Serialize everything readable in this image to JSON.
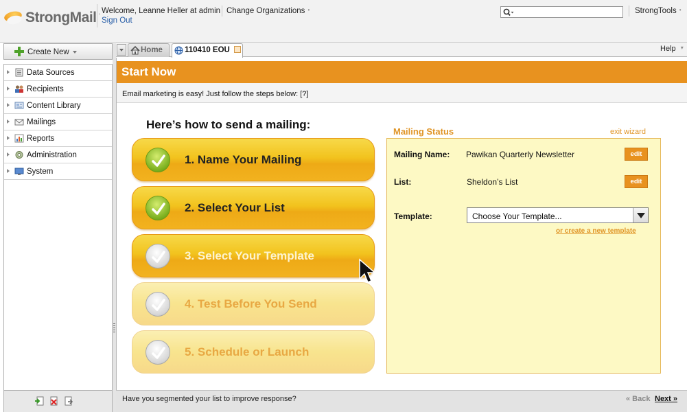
{
  "header": {
    "logo_text": "StrongMail",
    "welcome": "Welcome, Leanne Heller at admin",
    "sign_out": "Sign Out",
    "change_orgs": "Change Organizations",
    "strongtools": "StrongTools",
    "search_placeholder": ""
  },
  "sidebar": {
    "create_new": "Create New",
    "items": [
      {
        "label": "Data Sources",
        "icon": "data-sources-icon"
      },
      {
        "label": "Recipients",
        "icon": "recipients-icon"
      },
      {
        "label": "Content Library",
        "icon": "content-library-icon"
      },
      {
        "label": "Mailings",
        "icon": "mailings-icon"
      },
      {
        "label": "Reports",
        "icon": "reports-icon"
      },
      {
        "label": "Administration",
        "icon": "administration-icon"
      },
      {
        "label": "System",
        "icon": "system-icon"
      }
    ]
  },
  "tabs": {
    "home": "Home",
    "active": "110410 EOU",
    "help": "Help"
  },
  "main": {
    "banner": "Start Now",
    "intro": "Email marketing is easy! Just follow the steps below: [?]",
    "howto": "Here’s how to send a mailing:",
    "steps": [
      {
        "label": "1. Name Your Mailing"
      },
      {
        "label": "2. Select Your List"
      },
      {
        "label": "3. Select Your Template"
      },
      {
        "label": "4. Test Before You Send"
      },
      {
        "label": "5. Schedule or Launch"
      }
    ]
  },
  "status": {
    "title": "Mailing Status",
    "exit": "exit wizard",
    "mailing_name_label": "Mailing Name:",
    "mailing_name_value": "Pawikan Quarterly Newsletter",
    "list_label": "List:",
    "list_value": "Sheldon’s List",
    "template_label": "Template:",
    "template_value": "Choose Your Template...",
    "edit": "edit",
    "create_template": "or create a new template"
  },
  "footer": {
    "tip": "Have you segmented your list to improve response?",
    "back": "« Back",
    "next": "Next »"
  },
  "colors": {
    "brand_orange": "#e8921f",
    "step_active": "#f2c31e",
    "step_inactive": "#f8e48e",
    "status_bg": "#fdf9c4",
    "link_blue": "#2a5fa8"
  }
}
